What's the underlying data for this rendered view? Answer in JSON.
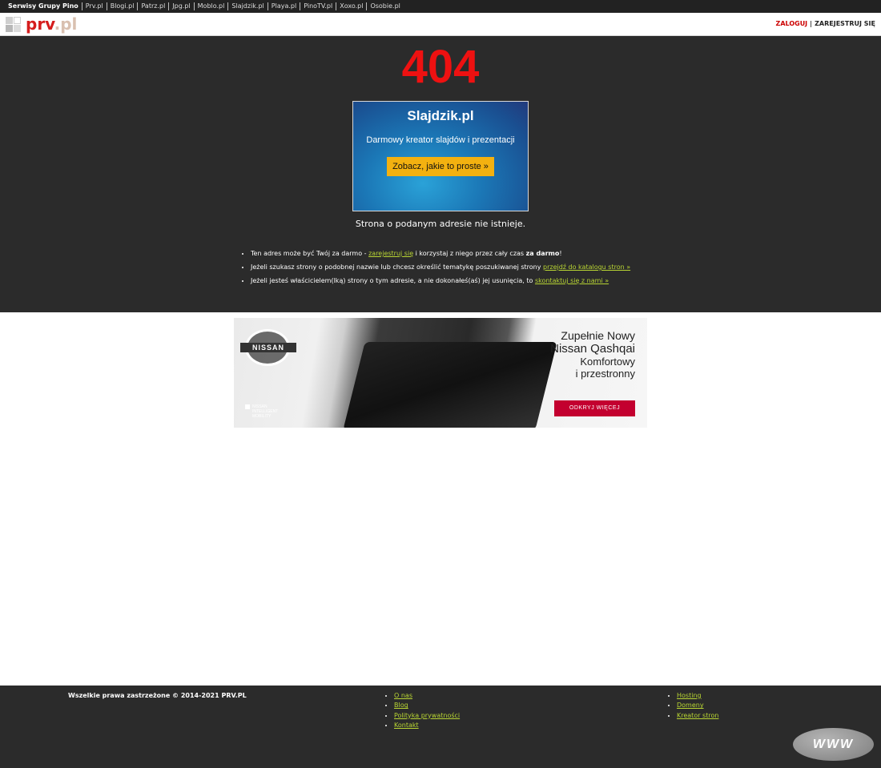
{
  "topbar": {
    "label": "Serwisy Grupy Pino",
    "sites": [
      "Prv.pl",
      "Blogi.pl",
      "Patrz.pl",
      "Jpg.pl",
      "Moblo.pl",
      "Slajdzik.pl",
      "Playa.pl",
      "PinoTV.pl",
      "Xoxo.pl",
      "Osobie.pl"
    ]
  },
  "header": {
    "logo_prefix": "prv",
    "logo_suffix": ".pl",
    "login_label": "ZALOGUJ",
    "separator": "|",
    "register_label": "ZAREJESTRUJ SIĘ"
  },
  "main": {
    "error_code": "404",
    "promo": {
      "title": "Slajdzik.pl",
      "subtitle": "Darmowy kreator slajdów i prezentacji",
      "button_label": "Zobacz, jakie to proste »"
    },
    "not_found_text": "Strona o podanym adresie nie istnieje.",
    "hints": [
      {
        "before": "Ten adres może być Twój za darmo - ",
        "link": "zarejestruj się",
        "after": " i korzystaj z niego przez cały czas ",
        "bold": "za darmo",
        "end": "!"
      },
      {
        "before": "Jeżeli szukasz strony o podobnej nazwie lub chcesz określić tematykę poszukiwanej strony ",
        "link": "przejdź do katalogu stron »"
      },
      {
        "before": "Jeżeli jesteś właścicielem(lką) strony o tym adresie, a nie dokonałeś(aś) jej usunięcia, to ",
        "link": "skontaktuj się z nami »"
      }
    ]
  },
  "ad": {
    "brand": "NISSAN",
    "headline_1": "Zupełnie Nowy",
    "headline_2": "Nissan Qashqai",
    "headline_3": "Komfortowy",
    "headline_4": "i przestronny",
    "cta_label": "ODKRYJ WIĘCEJ",
    "mobility_1": "NISSAN",
    "mobility_2": "INTELLIGENT",
    "mobility_3": "MOBILITY"
  },
  "footer": {
    "copyright": "Wszelkie prawa zastrzeżone © 2014-2021 PRV.PL",
    "col1": [
      "O nas",
      "Blog",
      "Polityka prywatności",
      "Kontakt"
    ],
    "col2": [
      "Hosting",
      "Domeny",
      "Kreator stron"
    ],
    "www_badge": "WWW"
  },
  "colors": {
    "accent_red": "#ee1111",
    "link_green": "#b8d433",
    "dark_bg": "#2b2b2b",
    "promo_button": "#f3b110",
    "nissan_red": "#c3002f"
  }
}
